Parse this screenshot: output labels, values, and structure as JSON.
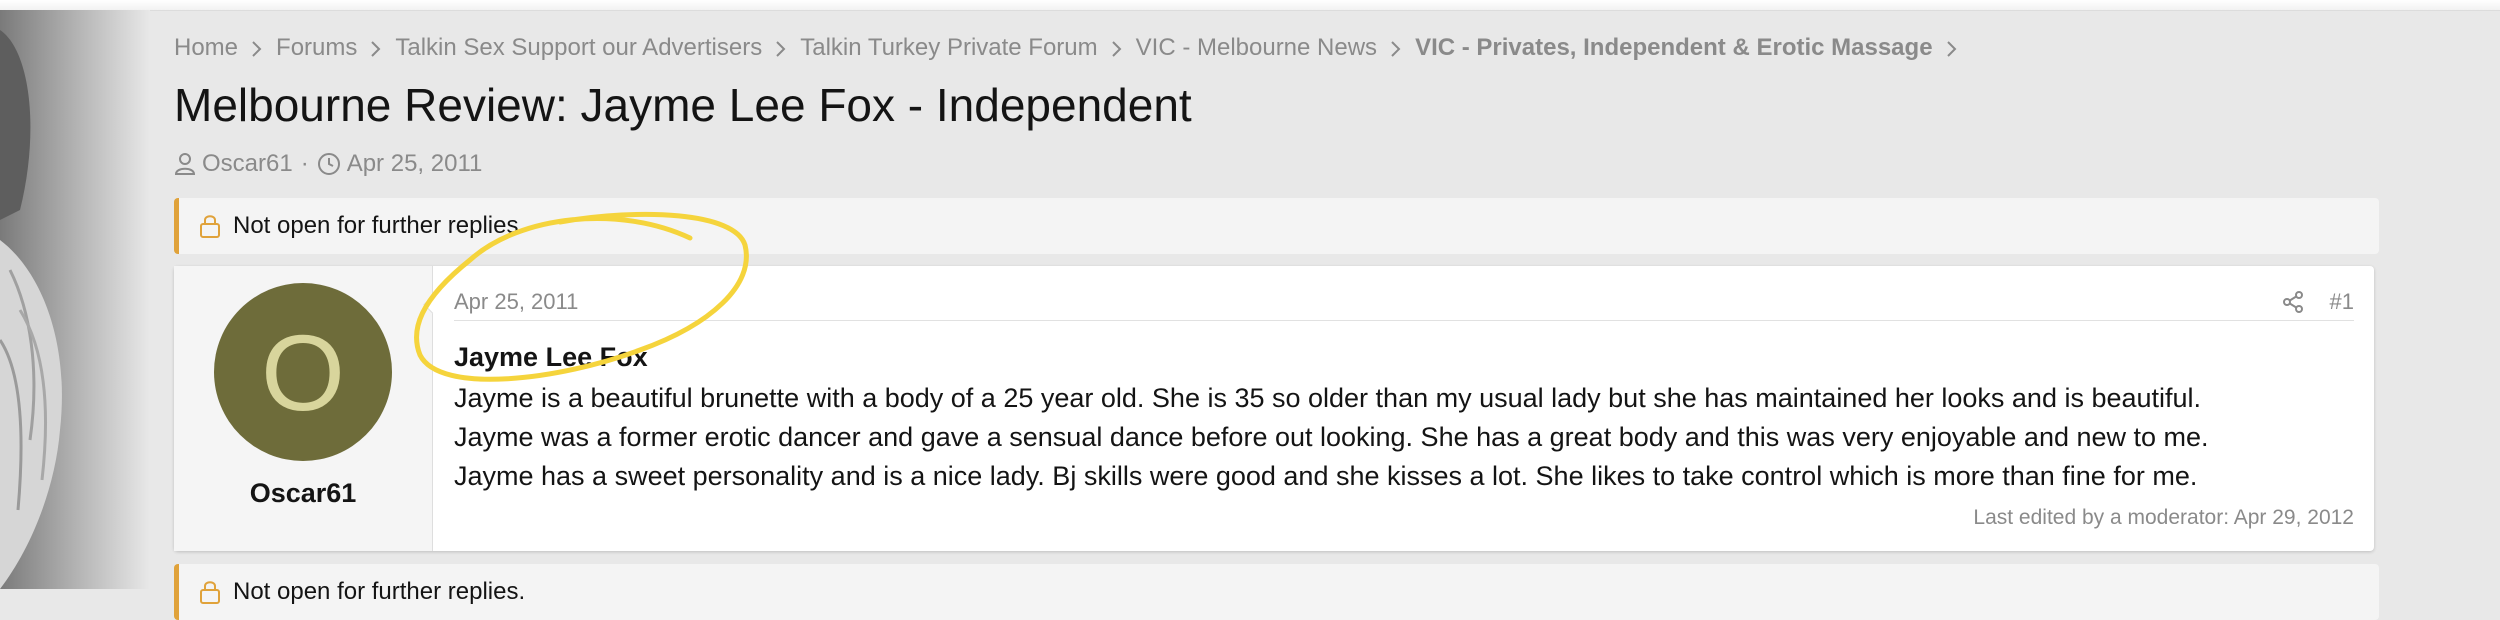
{
  "breadcrumb": {
    "items": [
      "Home",
      "Forums",
      "Talkin Sex Support our Advertisers",
      "Talkin Turkey Private Forum",
      "VIC - Melbourne News",
      "VIC - Privates, Independent & Erotic Massage"
    ]
  },
  "thread": {
    "title": "Melbourne Review: Jayme Lee Fox - Independent",
    "author": "Oscar61",
    "separator": "·",
    "date": "Apr 25, 2011",
    "notice": "Not open for further replies."
  },
  "post": {
    "avatar_letter": "O",
    "username": "Oscar61",
    "date": "Apr 25, 2011",
    "number": "#1",
    "subject": "Jayme Lee Fox",
    "lines": [
      "Jayme is a beautiful brunette with a body of a 25 year old. She is 35 so older than my usual lady but she has maintained her looks and is beautiful.",
      "Jayme was a former erotic dancer and gave a sensual dance before out looking. She has a great body and this was very enjoyable and new to me.",
      "Jayme has a sweet personality and is a nice lady. Bj skills were good and she kisses a lot. She likes to take control which is more than fine for me."
    ],
    "last_edited": "Last edited by a moderator: Apr 29, 2012"
  },
  "icons": {
    "user": "user-icon",
    "clock": "clock-icon",
    "lock": "lock-icon",
    "share": "share-icon",
    "chevron": "chevron-right-icon"
  },
  "colors": {
    "accent_notice": "#e0a23a",
    "avatar_bg": "#6e6c3a",
    "avatar_fg": "#d8d59c",
    "highlight_scribble": "#f5d43c",
    "muted_text": "#8a8a8a"
  }
}
